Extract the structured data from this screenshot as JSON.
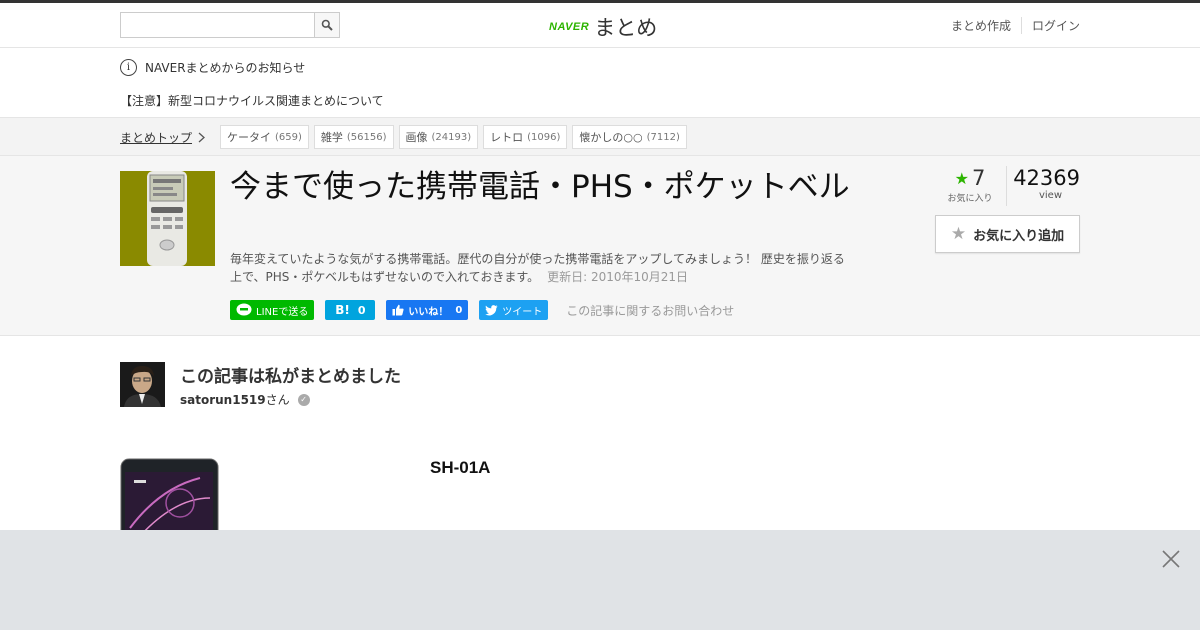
{
  "header": {
    "search_placeholder": "",
    "logo_naver": "NAVER",
    "logo_matome": "まとめ",
    "links": [
      "まとめ作成",
      "ログイン"
    ]
  },
  "notice": {
    "heading": "NAVERまとめからのお知らせ",
    "message": "【注意】新型コロナウイルス関連まとめについて"
  },
  "breadcrumb": {
    "home": "まとめトップ",
    "tags": [
      {
        "label": "ケータイ",
        "count": "(659)"
      },
      {
        "label": "雑学",
        "count": "(56156)"
      },
      {
        "label": "画像",
        "count": "(24193)"
      },
      {
        "label": "レトロ",
        "count": "(1096)"
      },
      {
        "label": "懐かしの○○",
        "count": "(7112)"
      }
    ]
  },
  "article": {
    "title": "今まで使った携帯電話・PHS・ポケットベル",
    "description": "毎年変えていたような気がする携帯電話。歴代の自分が使った携帯電話をアップしてみましょう！ 歴史を振り返る上で、PHS・ポケベルもはずせないので入れておきます。",
    "updated": "更新日: 2010年10月21日",
    "favorites_count": "7",
    "favorites_label": "お気に入り",
    "views_count": "42369",
    "views_label": "view",
    "fav_button": "お気に入り追加",
    "contact": "この記事に関するお問い合わせ"
  },
  "social": {
    "line": "LINEで送る",
    "hatena_icon": "B!",
    "hatena_count": "0",
    "facebook": "いいね！",
    "facebook_count": "0",
    "twitter": "ツイート"
  },
  "author": {
    "heading": "この記事は私がまとめました",
    "name": "satorun1519",
    "suffix": "さん"
  },
  "item": {
    "title": "SH-01A"
  },
  "colors": {
    "brand": "#2db400",
    "line": "#00b900",
    "hatena": "#00a4de",
    "facebook": "#1877f2",
    "twitter": "#1da1f2"
  }
}
